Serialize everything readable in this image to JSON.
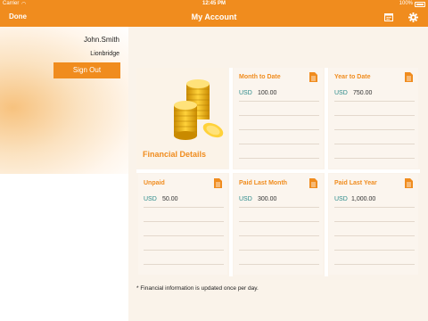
{
  "status_bar": {
    "carrier": "Carrier",
    "time": "12:45 PM",
    "battery": "100%"
  },
  "nav": {
    "done_label": "Done",
    "title": "My Account"
  },
  "user": {
    "name": "John.Smith",
    "company": "Lionbridge",
    "sign_out_label": "Sign Out"
  },
  "financial_title": "Financial Details",
  "cards": [
    {
      "title": "Month to Date",
      "currency": "USD",
      "amount": "100.00"
    },
    {
      "title": "Year to Date",
      "currency": "USD",
      "amount": "750.00"
    },
    {
      "title": "Unpaid",
      "currency": "USD",
      "amount": "50.00"
    },
    {
      "title": "Paid Last Month",
      "currency": "USD",
      "amount": "300.00"
    },
    {
      "title": "Paid Last Year",
      "currency": "USD",
      "amount": "1,000.00"
    }
  ],
  "footnote": "* Financial information is updated once per day.",
  "colors": {
    "accent": "#f08c1e",
    "currency": "#2b8a8a"
  },
  "icons": [
    "wifi-icon",
    "battery-icon",
    "calendar-icon",
    "gear-icon",
    "document-icon",
    "coins-icon"
  ]
}
